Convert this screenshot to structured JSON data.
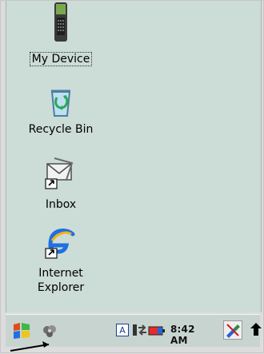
{
  "desktop": {
    "icons": [
      {
        "label": "My Device"
      },
      {
        "label": "Recycle Bin"
      },
      {
        "label": "Inbox"
      },
      {
        "label_line1": "Internet",
        "label_line2": "Explorer"
      }
    ]
  },
  "taskbar": {
    "time": "8:42 AM",
    "input_mode": "A"
  },
  "colors": {
    "desktop": "#ccdcd6",
    "taskbar": "#c8d4d0",
    "ie_blue": "#1f6fe0",
    "recycle_green": "#2aa75c"
  }
}
